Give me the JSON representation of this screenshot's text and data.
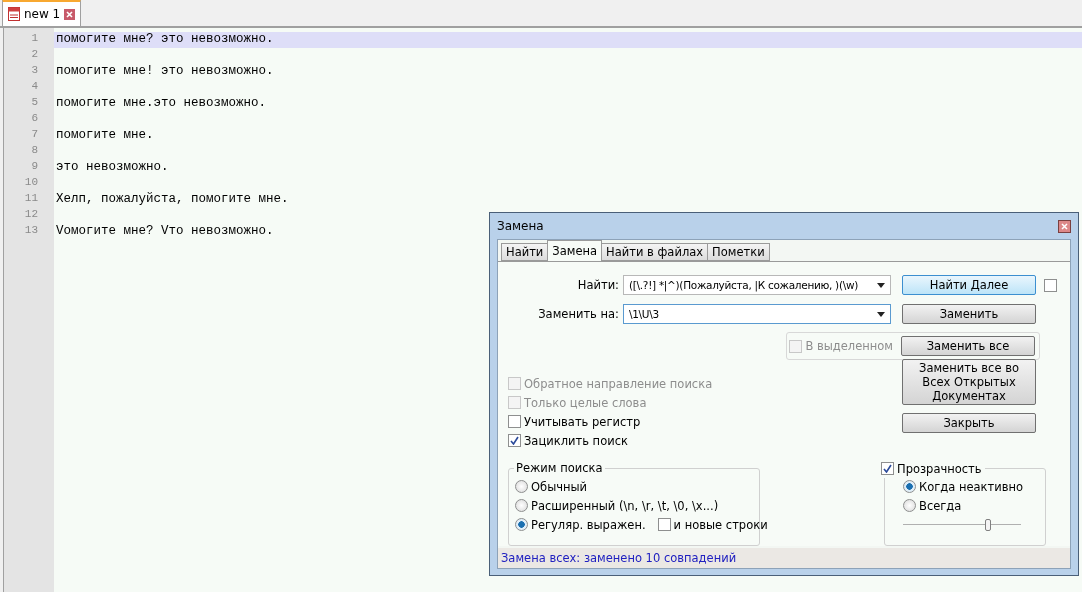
{
  "file_tabs": [
    {
      "label": "new 1",
      "selected": true
    }
  ],
  "editor": {
    "lines": [
      {
        "number": "1",
        "text": "помогите мне? это невозможно.",
        "current": true
      },
      {
        "number": "2",
        "current": false
      },
      {
        "number": "3",
        "text": "помогите мне! это невозможно.",
        "current": false
      },
      {
        "number": "4",
        "current": false
      },
      {
        "number": "5",
        "text": "помогите мне.это невозможно.",
        "current": false
      },
      {
        "number": "6",
        "current": false
      },
      {
        "number": "7",
        "text": "помогите мне.",
        "current": false
      },
      {
        "number": "8",
        "current": false
      },
      {
        "number": "9",
        "text": "это невозможно.",
        "current": false
      },
      {
        "number": "10",
        "current": false
      },
      {
        "number": "11",
        "text": "Хелп, пожалуйста, помогите мне.",
        "current": false
      },
      {
        "number": "12",
        "current": false
      },
      {
        "number": "13",
        "text": "Vомогите мне? Vто невозможно.",
        "current": false
      }
    ]
  },
  "dialog": {
    "title": "Замена",
    "tabs": [
      {
        "label": "Найти",
        "selected": false
      },
      {
        "label": "Замена",
        "selected": true
      },
      {
        "label": "Найти в файлах",
        "selected": false
      },
      {
        "label": "Пометки",
        "selected": false
      }
    ],
    "find": {
      "label": "Найти:",
      "value": "([\\.?!] *|^)(Пожалуйста, |К сожалению, )(\\w)"
    },
    "replace": {
      "label": "Заменить на:",
      "value": "\\1\\U\\3"
    },
    "find_next_button": "Найти Далее",
    "find_next_extra": {
      "checked": false
    },
    "replace_button": "Заменить",
    "in_selection": {
      "label": "В выделенном",
      "checked": false,
      "disabled": true
    },
    "replace_all_button": "Заменить все",
    "replace_all_docs_button": "Заменить все во Всех Открытых Документах",
    "close_button": "Закрыть",
    "options": [
      {
        "label": "Обратное направление поиска",
        "checked": false,
        "disabled": true
      },
      {
        "label": "Только целые слова",
        "checked": false,
        "disabled": true
      },
      {
        "label": "Учитывать регистр",
        "checked": false,
        "disabled": false
      },
      {
        "label": "Зациклить поиск",
        "checked": true,
        "disabled": false
      }
    ],
    "search_mode": {
      "title": "Режим поиска",
      "modes": [
        {
          "label": "Обычный",
          "selected": false
        },
        {
          "label": "Расширенный (\\n, \\r, \\t, \\0, \\x...)",
          "selected": false
        },
        {
          "label": "Регуляр. выражен.",
          "selected": true
        }
      ],
      "newlines": {
        "label": "и новые строки",
        "checked": false
      }
    },
    "transparency": {
      "label": "Прозрачность",
      "checked": true,
      "modes": [
        {
          "label": "Когда неактивно",
          "selected": true
        },
        {
          "label": "Всегда",
          "selected": false
        }
      ],
      "level": 0.72
    },
    "status": "Замена всех: заменено 10 совпадений"
  }
}
